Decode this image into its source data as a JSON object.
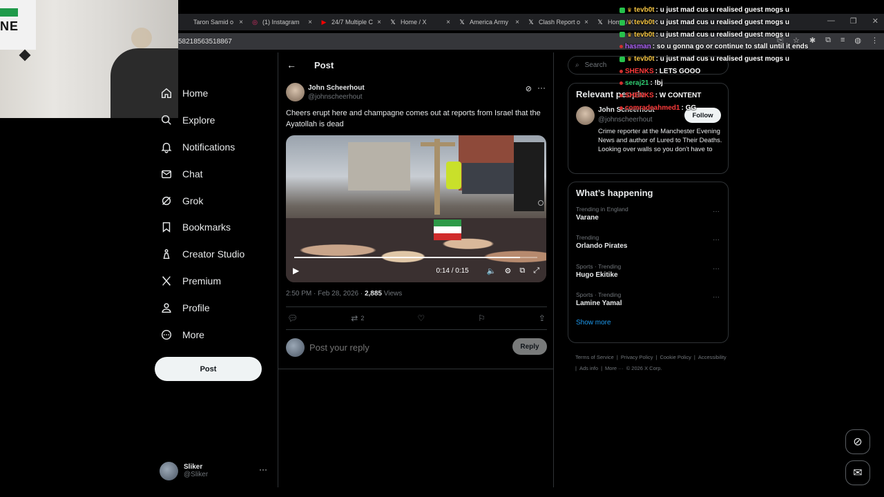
{
  "browser": {
    "tabs": [
      {
        "label": "Taron Samid o",
        "icon": "tab-icon",
        "color": "#888"
      },
      {
        "label": "(1) Instagram",
        "icon": "instagram-icon",
        "color": "#e1306c"
      },
      {
        "label": "24/7 Multiple C",
        "icon": "youtube-icon",
        "color": "#ff0000"
      },
      {
        "label": "Home / X",
        "icon": "x-logo-icon",
        "color": "#ffffff"
      },
      {
        "label": "America Army",
        "icon": "x-logo-icon",
        "color": "#ffffff"
      },
      {
        "label": "Clash Report o",
        "icon": "x-logo-icon",
        "color": "#ffffff"
      },
      {
        "label": "Home / X",
        "icon": "x-logo-icon",
        "color": "#ffffff"
      }
    ],
    "url": "58218563518867"
  },
  "webcam": {
    "sign_text": "NE"
  },
  "nav": {
    "items": [
      {
        "label": "Home",
        "icon": "home-icon"
      },
      {
        "label": "Explore",
        "icon": "search-icon"
      },
      {
        "label": "Notifications",
        "icon": "bell-icon"
      },
      {
        "label": "Chat",
        "icon": "mail-icon"
      },
      {
        "label": "Grok",
        "icon": "grok-icon"
      },
      {
        "label": "Bookmarks",
        "icon": "bookmark-icon"
      },
      {
        "label": "Creator Studio",
        "icon": "creator-studio-icon"
      },
      {
        "label": "Premium",
        "icon": "x-logo-icon"
      },
      {
        "label": "Profile",
        "icon": "person-icon"
      },
      {
        "label": "More",
        "icon": "more-circle-icon"
      }
    ],
    "post_label": "Post",
    "account": {
      "name": "Sliker",
      "handle": "@Sliker"
    }
  },
  "post": {
    "header_title": "Post",
    "author_name": "John Scheerhout",
    "author_handle": "@johnscheerhout",
    "text": "Cheers erupt here and champagne comes out at reports from Israel that the Ayatollah is dead",
    "video": {
      "time": "0:14 / 0:15",
      "progress": 0.93
    },
    "timestamp": "2:50 PM · Feb 28, 2026 · ",
    "views_count": "2,885",
    "views_label": " Views",
    "retweet_count": "2",
    "reply_placeholder": "Post your reply",
    "reply_button": "Reply"
  },
  "sidebar": {
    "search_placeholder": "Search",
    "relevant_title": "Relevant people",
    "person": {
      "name": "John Scheerhout",
      "handle": "@johnscheerhout",
      "bio": "Crime reporter at the Manchester Evening News and author of Lured to Their Deaths. Looking over walls so you don't have to",
      "follow_label": "Follow"
    },
    "happening_title": "What’s happening",
    "trends": [
      {
        "context": "Trending in England",
        "name": "Varane"
      },
      {
        "context": "Trending",
        "name": "Orlando Pirates"
      },
      {
        "context": "Sports · Trending",
        "name": "Hugo Ekitike"
      },
      {
        "context": "Sports · Trending",
        "name": "Lamine Yamal"
      }
    ],
    "show_more": "Show more",
    "footer": [
      "Terms of Service",
      "|",
      "Privacy Policy",
      "|",
      "Cookie Policy",
      "|",
      "Accessibility",
      "|",
      "Ads info",
      "|",
      "More ···",
      "© 2026 X Corp."
    ]
  },
  "chat": {
    "messages": [
      {
        "user": "tevb0t",
        "text": ": u just mad cus u realised guest mogs u",
        "color": "#f5c542",
        "badge": "#27c24c"
      },
      {
        "user": "tevb0t",
        "text": ": u just mad cus u realised guest mogs u",
        "color": "#f5c542",
        "badge": "#27c24c"
      },
      {
        "user": "tevb0t",
        "text": ": u just mad cus u realised guest mogs u",
        "color": "#f5c542",
        "badge": "#27c24c"
      },
      {
        "user": "hasman",
        "text": ": so u gonna go or continue to stall until it ends",
        "color": "#b366ff",
        "badge": ""
      },
      {
        "user": "tevb0t",
        "text": ": u just mad cus u realised guest mogs u",
        "color": "#f5c542",
        "badge": "#27c24c"
      },
      {
        "user": "SHENKS",
        "text": ": LETS GOOO",
        "color": "#ff3b3b",
        "badge": ""
      },
      {
        "user": "seraj21",
        "text": ": !bj",
        "color": "#2ecc71",
        "badge": ""
      },
      {
        "user": "SHENKS",
        "text": ": W CONTENT",
        "color": "#ff3b3b",
        "badge": ""
      },
      {
        "user": "comradeahmed1",
        "text": ": GG",
        "color": "#ff3b3b",
        "badge": ""
      }
    ]
  }
}
